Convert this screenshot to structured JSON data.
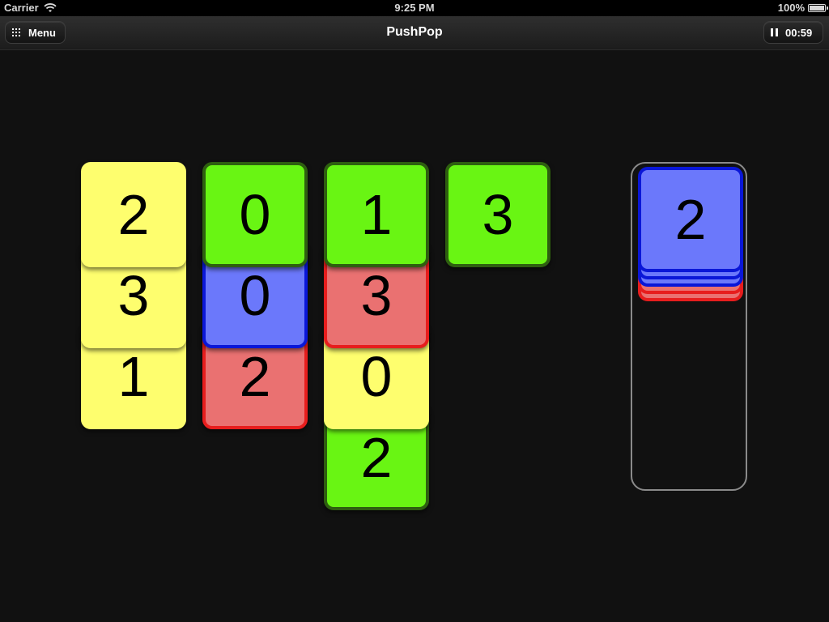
{
  "status_bar": {
    "carrier": "Carrier",
    "time": "9:25 PM",
    "battery": "100%"
  },
  "nav": {
    "title": "PushPop",
    "menu_label": "Menu",
    "timer": "00:59"
  },
  "columns": [
    {
      "tiles": [
        {
          "value": "1",
          "color": "yellow"
        },
        {
          "value": "3",
          "color": "yellow"
        },
        {
          "value": "2",
          "color": "yellow"
        }
      ]
    },
    {
      "tiles": [
        {
          "value": "2",
          "color": "red"
        },
        {
          "value": "0",
          "color": "blue"
        },
        {
          "value": "0",
          "color": "green"
        }
      ]
    },
    {
      "tiles": [
        {
          "value": "2",
          "color": "green"
        },
        {
          "value": "0",
          "color": "yellow"
        },
        {
          "value": "3",
          "color": "red"
        },
        {
          "value": "1",
          "color": "green"
        }
      ]
    },
    {
      "tiles": [
        {
          "value": "3",
          "color": "green"
        }
      ]
    }
  ],
  "stack": {
    "tiles": [
      {
        "value": "",
        "color": "red"
      },
      {
        "value": "",
        "color": "red"
      },
      {
        "value": "",
        "color": "blue"
      },
      {
        "value": "",
        "color": "blue"
      },
      {
        "value": "2",
        "color": "blue"
      }
    ]
  },
  "colors": {
    "yellow": "#fefe6e",
    "green": "#69f513",
    "blue": "#6b78fb",
    "red": "#ea7171",
    "background": "#111111"
  }
}
